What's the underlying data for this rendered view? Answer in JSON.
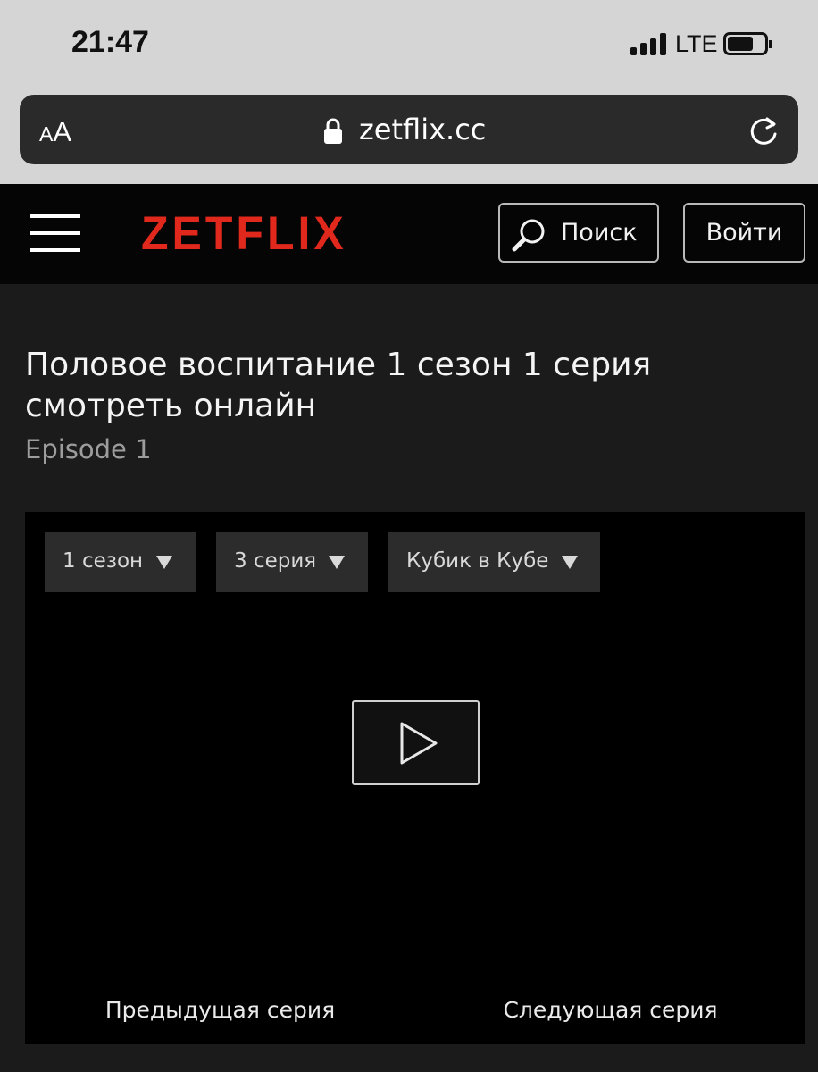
{
  "status_bar": {
    "time": "21:47",
    "network": "LTE",
    "icons": [
      "signal-icon",
      "battery-icon"
    ]
  },
  "browser": {
    "text_size_small": "A",
    "text_size_big": "A",
    "url": "zetflix.cc",
    "icons": [
      "lock-icon",
      "reload-icon"
    ]
  },
  "header": {
    "logo": "ZETFLIX",
    "search_label": "Поиск",
    "login_label": "Войти",
    "brand_color": "#e1281c",
    "icons": [
      "menu-icon",
      "search-icon"
    ]
  },
  "page": {
    "title": "Половое воспитание 1 сезон 1 серия смотреть онлайн",
    "subtitle": "Episode 1"
  },
  "player": {
    "season_select": "1 сезон",
    "episode_select": "3 серия",
    "voice_select": "Кубик в Кубе",
    "prev_episode": "Предыдущая серия",
    "next_episode": "Следующая серия",
    "icons": [
      "play-icon",
      "chevron-down-icon"
    ]
  }
}
